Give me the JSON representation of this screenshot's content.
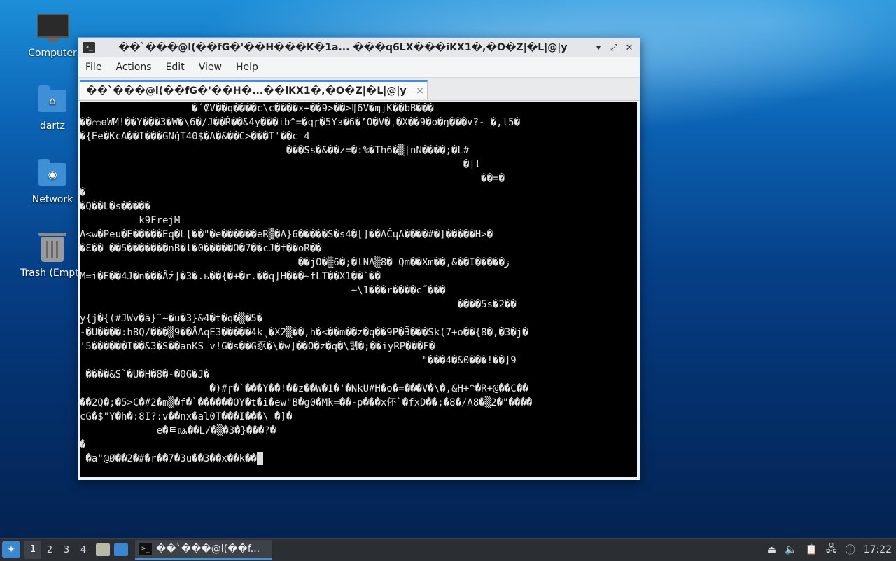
{
  "desktop": {
    "icons": [
      {
        "label": "Computer"
      },
      {
        "label": "dartz"
      },
      {
        "label": "Network"
      },
      {
        "label": "Trash (Empty)"
      }
    ]
  },
  "window": {
    "title": "��`���@l(��fG�'��H���K�1a... ���q6LX���iKX1�,�O�Z|�L|@|y",
    "menu": [
      "File",
      "Actions",
      "Edit",
      "View",
      "Help"
    ],
    "tab_label": "��`���@l(��fG�'��H�...��iKX1�,�O�Z|�L|@|y",
    "tab_close": "×",
    "controls": {
      "minimize": "▾",
      "maximize": "⤢",
      "close": "✕"
    }
  },
  "terminal": {
    "lines": [
      "                   �´₡V��q����c\\c����x+��9>��>ʧ6V�ɱjK��bB���",
      "��ကɵWM!��Y���3�W�\\6�/J��Ŕ��&4y���ib^=�qɼ�5Yɜ�6�ʼO�V�ˌ�X��9�o�ŋ���v?- �,l5�",
      "�{Ee�KcA��I���GNģT40$�A�&��C>���T'��c 4",
      "                                   ���Ss�&��z=�:%�Th6�▒|nN����;�L#",
      "                                                                 �|t",
      "                                                                    ��=�",
      "�",
      "�Q��L�s�����_",
      "          k9FrejM",
      "A<w�Peu�E�����Eq�L[��\"�e������eR▒�A}6�����S�s4�[]��AĊɥA����#�]�����H>�",
      "�Ɛ�� ��5�������nB�l�0�����O�7��cJ�f��oR��",
      "                                     ��jO�▒6�;�lNA▒8� Qm��Xm��,&��I�����ڗ",
      "M=i�E��4J�n���Ấz]�3�.ь��{�+�r.��q]H���~fLT��X1��`��",
      "                                              ~\\1���r����c˝���",
      "                                                                ����5s�2��",
      "y{ɉ�{(#JWv�ä}˜~�u�3}&4�t�q�▒�5�",
      "-�U����:h8Q/���▒9��ÅAqE3�����4k˳�X2▒��,h�<��m��z�q��9P�Ӭ���Sk(7+o��{8�,�3�j�",
      "'5������I��&3�S��anKS v!G�s��G豕�\\�w]��O�z�q�\\퀡�;��iyRP���F�",
      "                                                          \"���4�&0���!��]9",
      " ����&S`�U�H�8�-�0G�J�",
      "                      �)#ɼ�`���Y��!��z��W�1�'�NkU#H�o�=���V�\\�,&H+^�R+@��C��",
      "��2Q�;�5>C�#2�m▒�f�`������OY�t�i�ew\"B�g0�Mk=��-p���x伓`�fxD��;�8�/A8�▒2�\"����",
      "cG�$\"Y�h�:8I?:v��nx�al0T���I���\\_�]�",
      "             e�ㅌ꧘��L/�▒�3�}���?�",
      "�",
      " �a\"@Ø��2�#�r��7�3u��3��x��k��"
    ]
  },
  "taskbar": {
    "workspaces": [
      "1",
      "2",
      "3",
      "4"
    ],
    "task_label": "��`���@l(��f...",
    "clock": "17:22"
  }
}
